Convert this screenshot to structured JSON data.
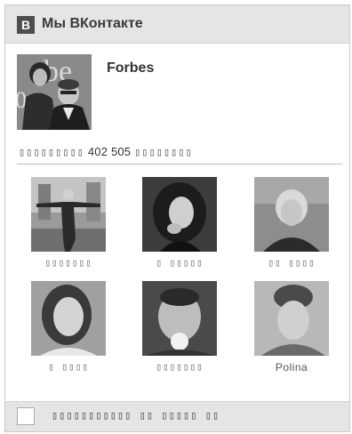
{
  "header": {
    "logo_letter": "В",
    "title": "Мы ВКонтакте"
  },
  "group": {
    "name": "Forbes"
  },
  "subscribers": {
    "prefix": "▯▯▯▯▯▯▯▯▯",
    "count": "402 505",
    "suffix": "▯▯▯▯▯▯▯▯"
  },
  "members": [
    {
      "name": "▯▯▯▯▯▯▯"
    },
    {
      "name": "▯ ▯▯▯▯▯"
    },
    {
      "name": "▯▯ ▯▯▯▯"
    },
    {
      "name": "▯ ▯▯▯▯"
    },
    {
      "name": "▯▯▯▯▯▯▯"
    },
    {
      "name": "Polina"
    }
  ],
  "footer": {
    "checkbox_label": "▯▯▯▯▯▯▯▯▯▯▯ ▯▯ ▯▯▯▯▯ ▯▯"
  }
}
